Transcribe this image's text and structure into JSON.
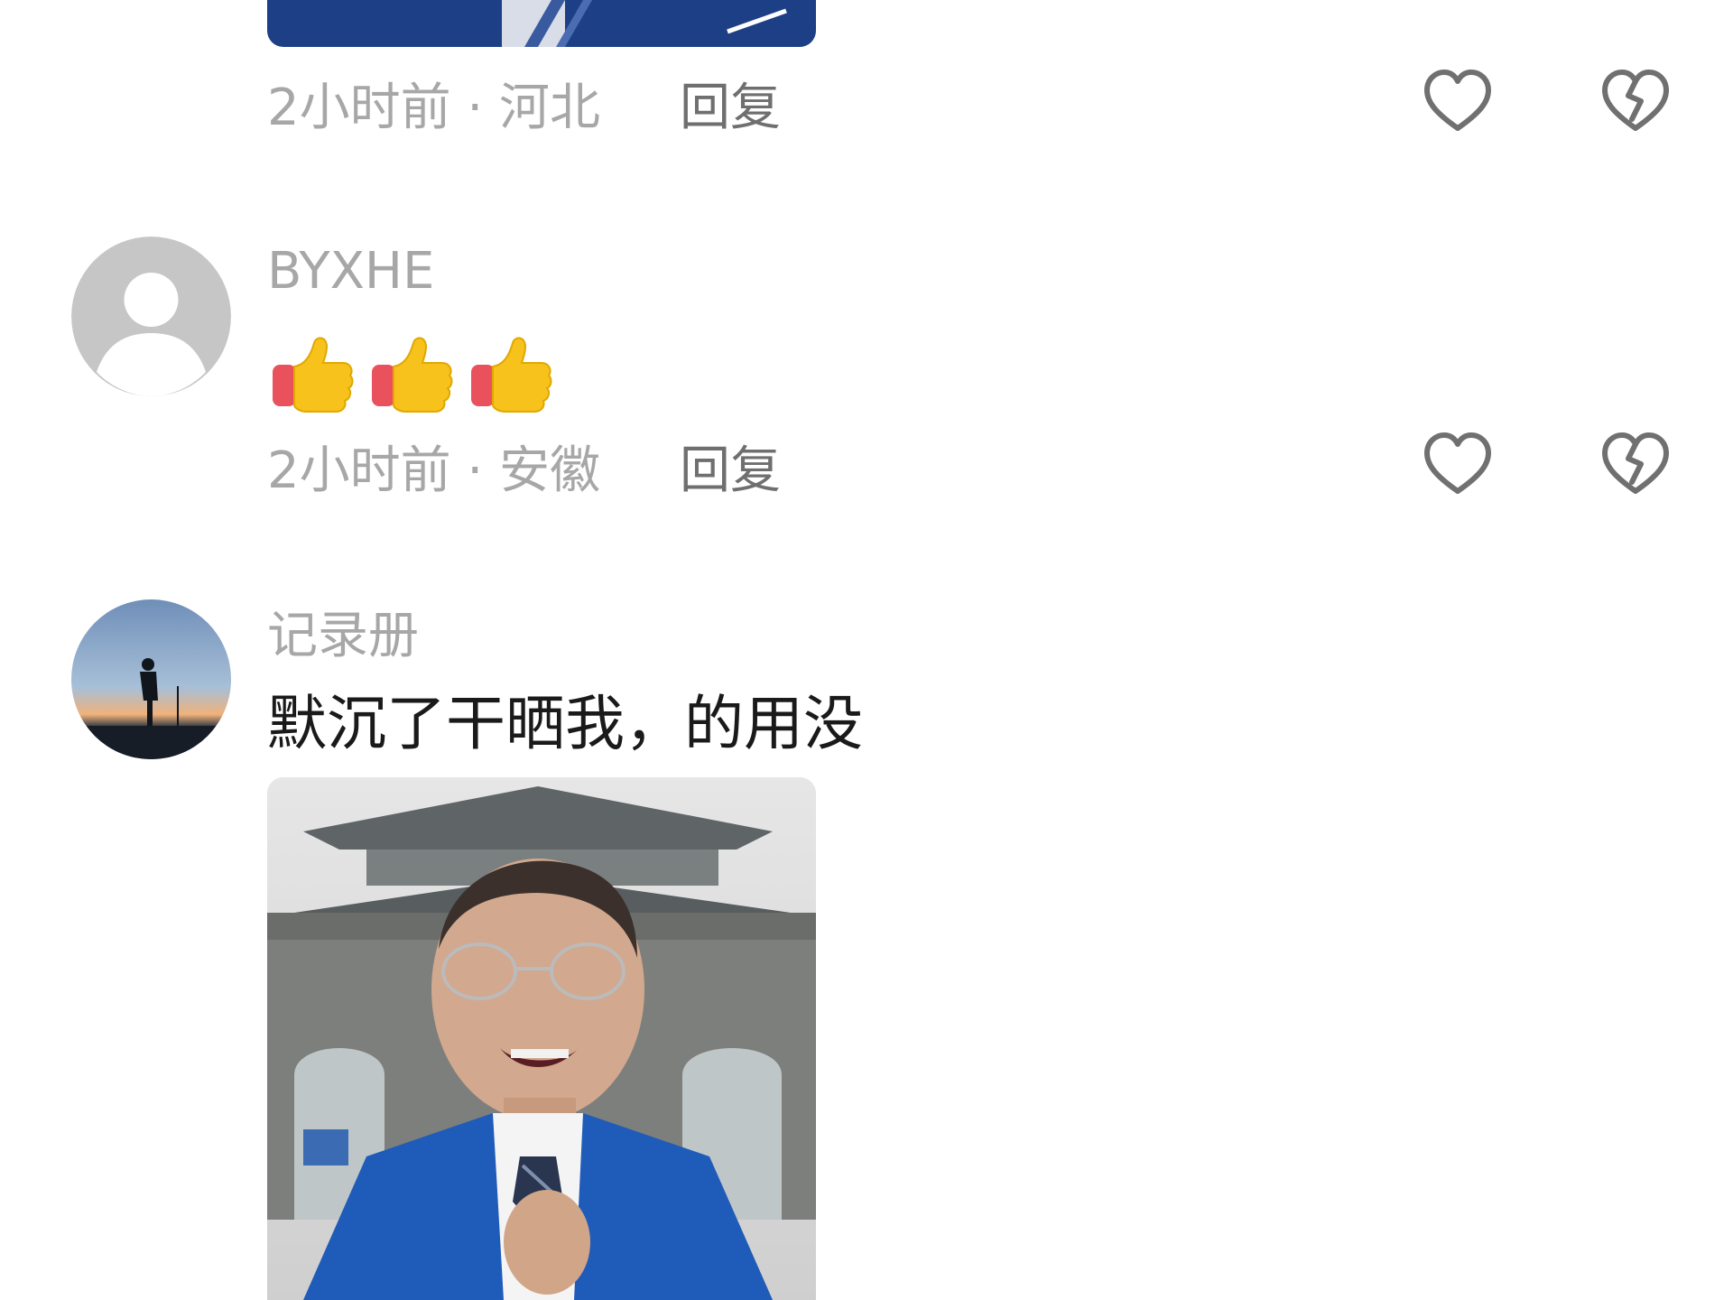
{
  "comments": [
    {
      "meta": "2小时前 · 河北",
      "reply_label": "回复"
    },
    {
      "username": "BYXHE",
      "emoji": [
        "thumbs-up",
        "thumbs-up",
        "thumbs-up"
      ],
      "meta": "2小时前 · 安徽",
      "reply_label": "回复"
    },
    {
      "username": "记录册",
      "text": "默沉了干晒我，的用没"
    }
  ],
  "colors": {
    "meta_text": "#a7a7a7",
    "reply_text": "#6f6f6f",
    "body_text": "#1a1a1a",
    "icon_stroke": "#707070"
  }
}
